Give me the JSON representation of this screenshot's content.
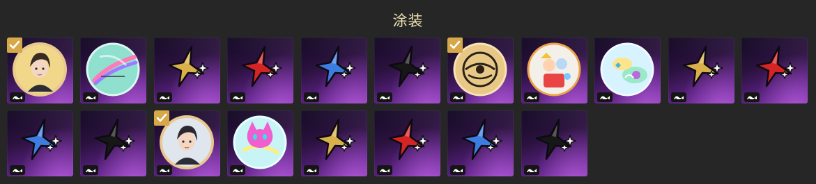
{
  "header": {
    "title": "涂装"
  },
  "colors": {
    "gold": "#d9b049",
    "red": "#d52424",
    "blue": "#3d7de0",
    "black": "#171717",
    "check_badge": "#d6a84a"
  },
  "skins": [
    {
      "icon": "portrait-disc-icon",
      "variant": "portrait-a",
      "equipped": true
    },
    {
      "icon": "rainbow-disc-icon",
      "variant": "rainbow",
      "equipped": false
    },
    {
      "icon": "gold-star-icon",
      "variant": "gold",
      "equipped": false
    },
    {
      "icon": "red-star-icon",
      "variant": "red",
      "equipped": false
    },
    {
      "icon": "blue-star-icon",
      "variant": "blue",
      "equipped": false
    },
    {
      "icon": "black-star-icon",
      "variant": "black",
      "equipped": false
    },
    {
      "icon": "gold-medallion-icon",
      "variant": "medallion",
      "equipped": true
    },
    {
      "icon": "cartoon-disc-icon",
      "variant": "cartoon",
      "equipped": false
    },
    {
      "icon": "pastel-disc-icon",
      "variant": "pastel",
      "equipped": false
    },
    {
      "icon": "gold-star-icon",
      "variant": "gold",
      "equipped": false
    },
    {
      "icon": "red-star-icon",
      "variant": "red",
      "equipped": false
    },
    {
      "icon": "blue-star-icon",
      "variant": "blue",
      "equipped": false
    },
    {
      "icon": "black-star-icon",
      "variant": "black",
      "equipped": false
    },
    {
      "icon": "portrait-disc-icon",
      "variant": "portrait-b",
      "equipped": true
    },
    {
      "icon": "pink-cat-disc-icon",
      "variant": "cat",
      "equipped": false
    },
    {
      "icon": "gold-star-icon",
      "variant": "gold",
      "equipped": false
    },
    {
      "icon": "red-star-icon",
      "variant": "red",
      "equipped": false
    },
    {
      "icon": "blue-star-icon",
      "variant": "blue",
      "equipped": false
    },
    {
      "icon": "black-star-icon",
      "variant": "black",
      "equipped": false
    }
  ]
}
